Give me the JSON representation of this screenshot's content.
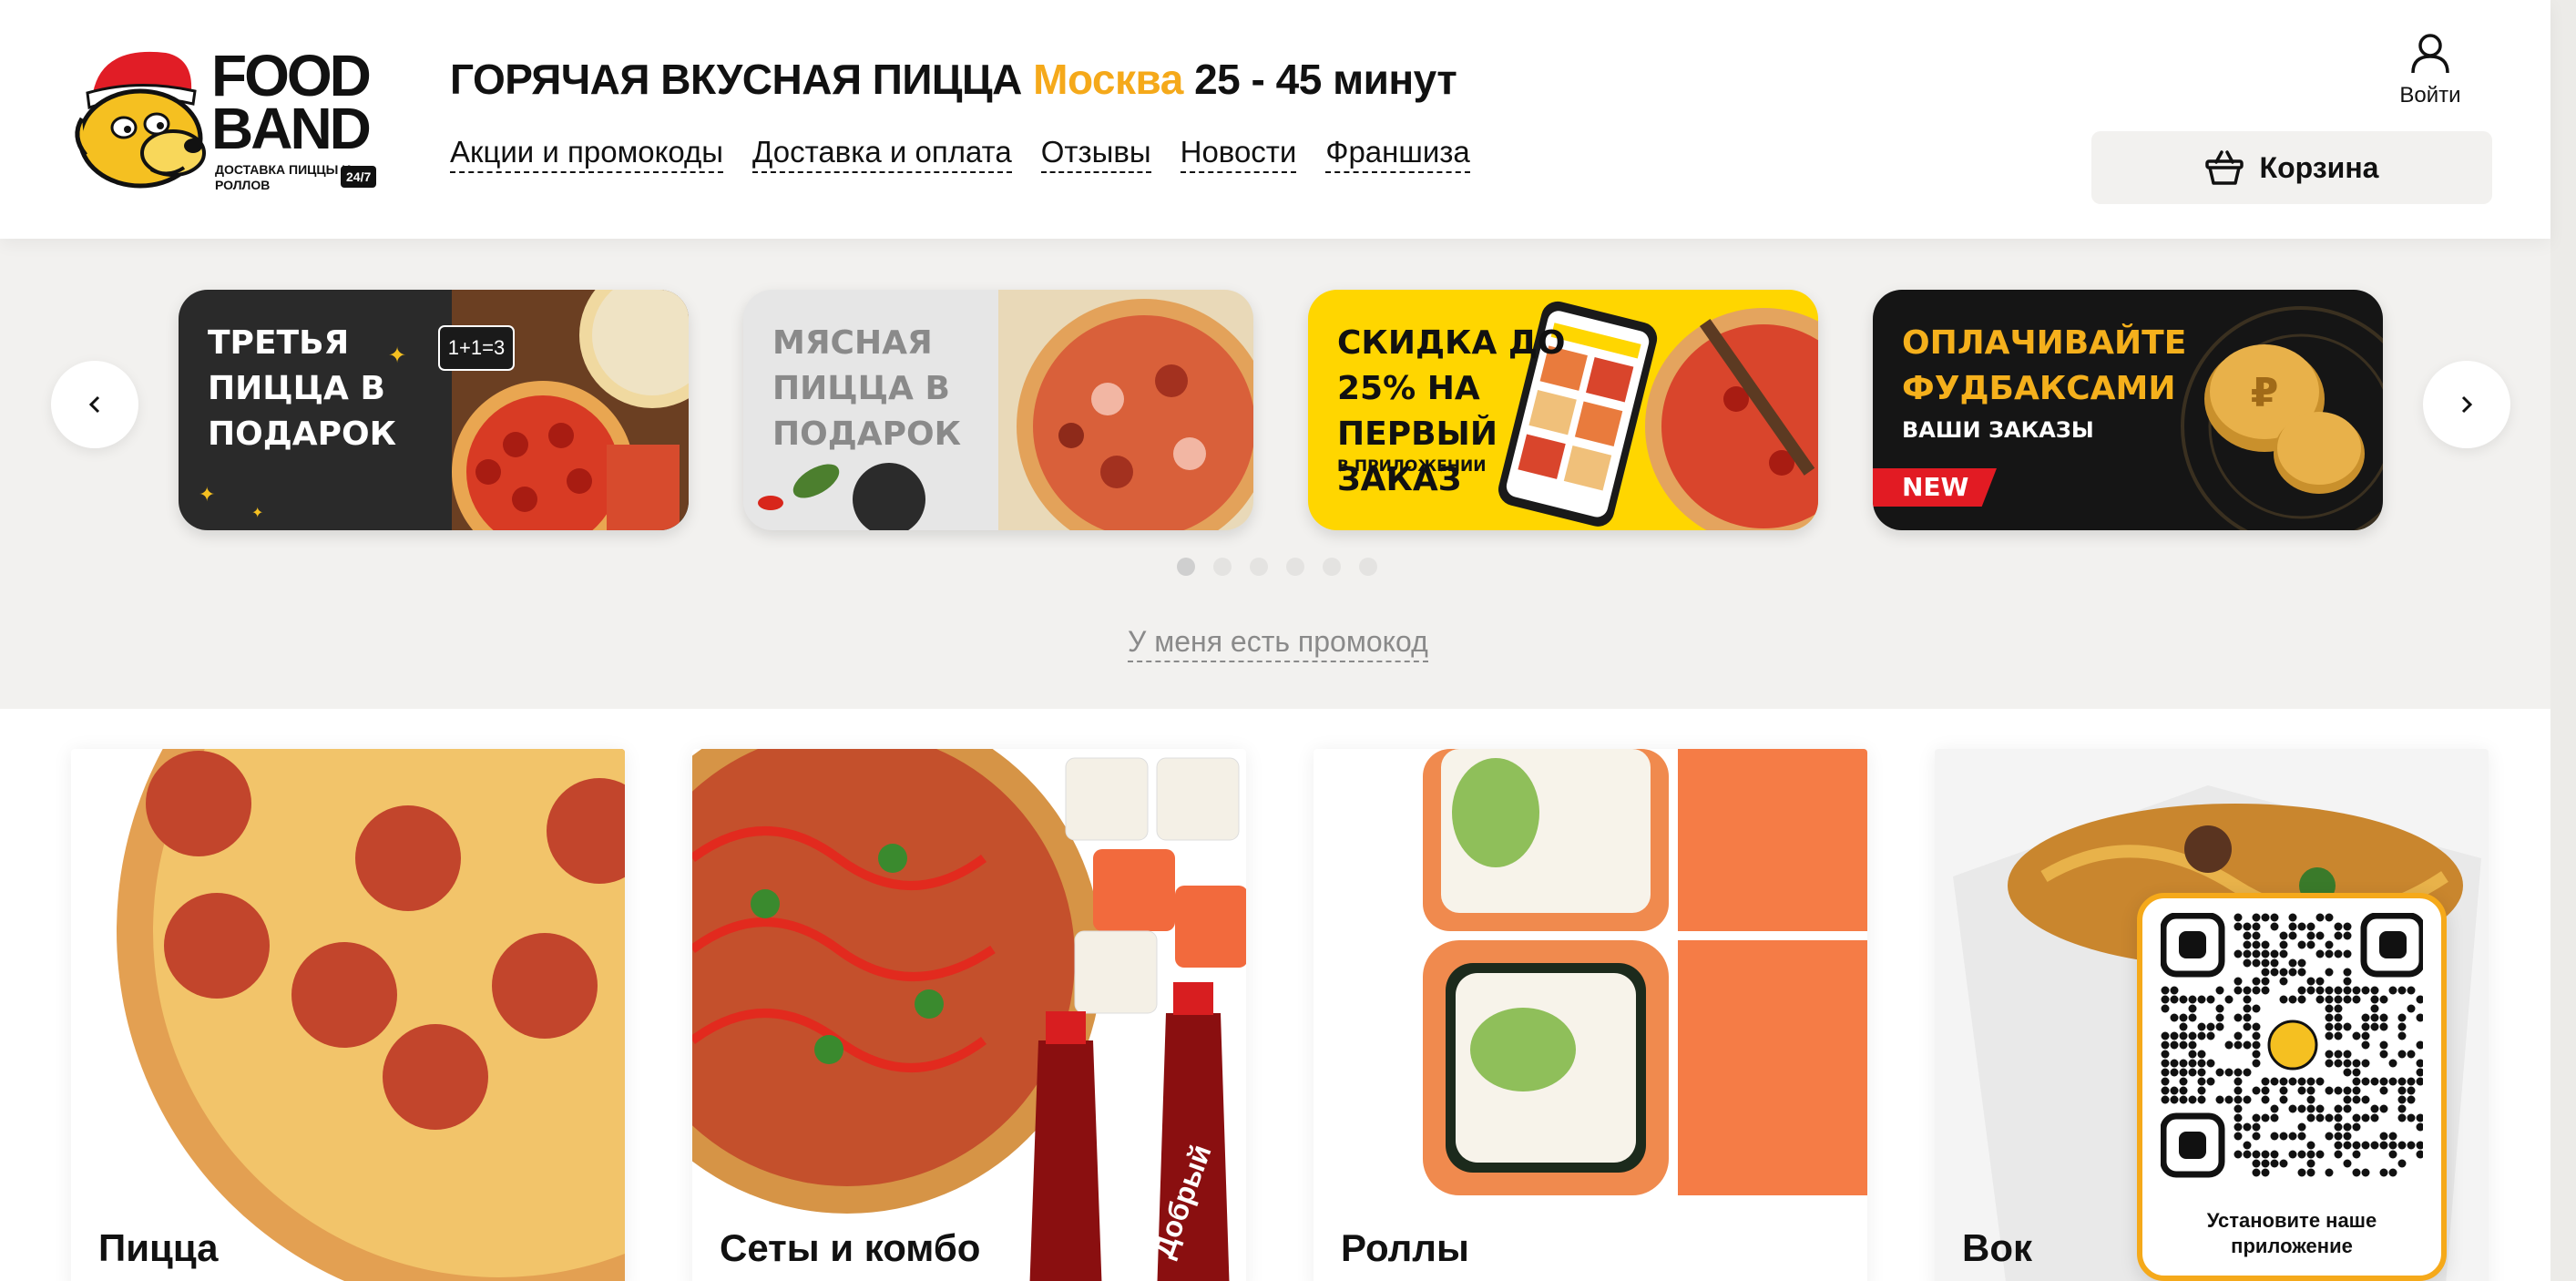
{
  "logo": {
    "line1": "FOOD",
    "line2": "BAND",
    "subtitle": "доставка пиццы и роллов",
    "badge": "24/7",
    "icon": "bear-mascot-icon"
  },
  "header": {
    "headline_main": "ГОРЯЧАЯ ВКУСНАЯ ПИЦЦА",
    "city": "Москва",
    "delivery_time": "25 - 45 минут",
    "nav": [
      "Акции и промокоды",
      "Доставка и оплата",
      "Отзывы",
      "Новости",
      "Франшиза"
    ],
    "login_label": "Войти",
    "login_icon": "user-icon",
    "cart_label": "Корзина",
    "cart_icon": "basket-icon"
  },
  "banners": {
    "items": [
      {
        "text": "Третья пицца в подарок",
        "small": "1+1=3"
      },
      {
        "text": "Мясная пицца в подарок"
      },
      {
        "text": "Скидка до 25% на первый заказ",
        "small": "в приложении"
      },
      {
        "text": "Оплачивайте фудбаксами",
        "small": "ваши заказы",
        "badge": "NEW"
      }
    ],
    "dots_count": 6,
    "active_dot": 0,
    "promo_link": "У меня есть промокод",
    "colors": {
      "yellow": "#ffd600",
      "dark": "#151515",
      "accent": "#f5a91a"
    }
  },
  "categories": [
    {
      "title": "Пицца"
    },
    {
      "title": "Сеты и комбо",
      "bottle_label": "Добрый"
    },
    {
      "title": "Роллы"
    },
    {
      "title": "Вок"
    }
  ],
  "qr": {
    "caption": "Установите наше приложение"
  }
}
